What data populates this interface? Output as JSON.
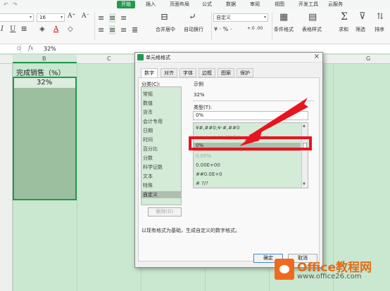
{
  "menubar": {
    "undo": "↶",
    "redo": "↷",
    "tabs": [
      "开始",
      "插入",
      "页面布局",
      "公式",
      "数据",
      "审阅",
      "视图",
      "开发工具",
      "云服务"
    ]
  },
  "ribbon": {
    "font_size": "16",
    "number_format": "自定义",
    "bold": "I",
    "merge_label": "合并居中",
    "wrap_label": "自动换行",
    "currency_glyphs": "¥ · % ·",
    "decimal_glyphs": "+.0 .00",
    "conditional_label": "条件格式",
    "table_style_label": "表格样式",
    "sum_label": "求和",
    "filter_label": "筛选",
    "sort_label": "排序"
  },
  "formula_bar": {
    "fx": "fx",
    "zoom_icon": "Q",
    "value": "32%"
  },
  "sheet": {
    "col_b": "B",
    "col_c": "C",
    "col_g": "G",
    "title_cell": "完成销售（%）",
    "first_value": "32%"
  },
  "dialog": {
    "title": "单元格格式",
    "close": "×",
    "tabs": [
      "数字",
      "对齐",
      "字体",
      "边框",
      "图案",
      "保护"
    ],
    "category_label": "分类(C):",
    "categories": [
      "常规",
      "数值",
      "货币",
      "会计专用",
      "日期",
      "时间",
      "百分比",
      "分数",
      "科学记数",
      "文本",
      "特殊",
      "自定义"
    ],
    "sample_label": "示例",
    "sample_value": "32%",
    "type_label": "类型(T):",
    "type_value": "0%",
    "types": [
      "¥#,##0;¥-#,##0",
      "¥#,##0.00;[红色]¥-#,##0.00",
      "0%",
      "0.00%",
      "0.00E+00",
      "##0.0E+0",
      "# ?/?"
    ],
    "delete_button": "删除(D)",
    "description": "以现有格式为基础，生成自定义的数字格式。",
    "ok": "确定",
    "cancel": "取消"
  },
  "watermark": {
    "brand": "Office教程网",
    "url": "www.office26.com"
  },
  "colors": {
    "accent": "#1f9a4d",
    "callout": "#e8141f",
    "sheet_bg": "#c9e8cf"
  }
}
